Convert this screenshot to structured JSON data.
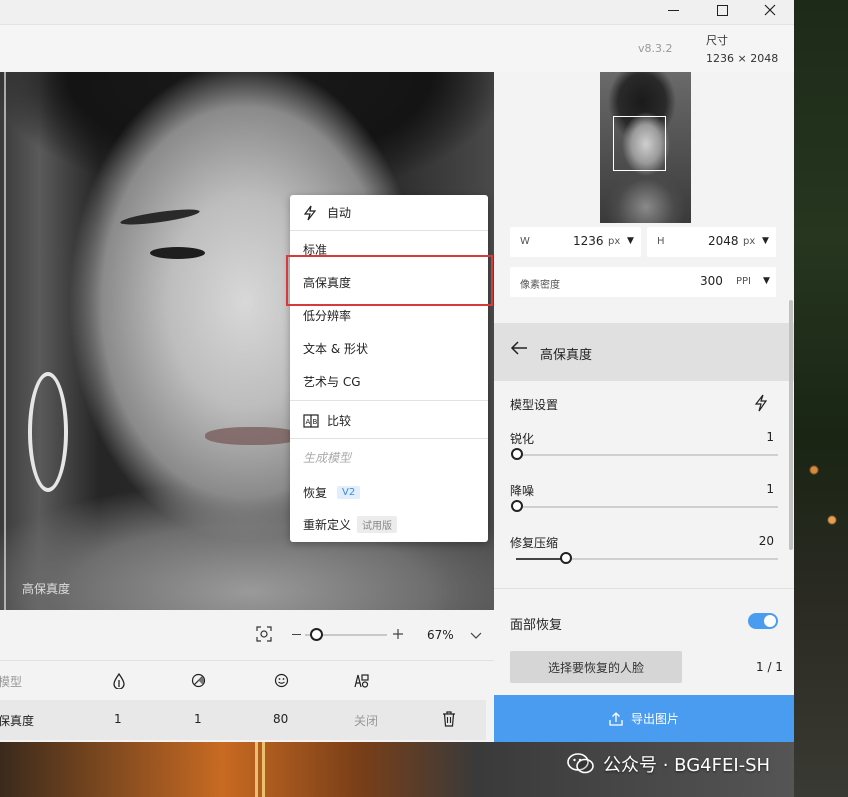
{
  "window": {
    "controls": {
      "minimize": "—",
      "maximize": "☐",
      "close": "✕"
    },
    "version": "v8.3.2",
    "size_label": "尺寸",
    "size_value": "1236 × 2048"
  },
  "preview": {
    "overlay_label": "高保真度"
  },
  "menu": {
    "items": [
      {
        "label": "自动",
        "icon": "lightning-icon"
      },
      {
        "label": "标准"
      },
      {
        "label": "高保真度",
        "highlighted": true
      },
      {
        "label": "低分辨率"
      },
      {
        "label": "文本 & 形状"
      },
      {
        "label": "艺术与 CG"
      },
      {
        "label": "比较",
        "icon": "compare-icon"
      },
      {
        "label": "生成模型",
        "disabled": true
      },
      {
        "label": "恢复",
        "badge": "V2"
      },
      {
        "label": "重新定义",
        "badge": "试用版"
      }
    ]
  },
  "zoom": {
    "percent": "67%"
  },
  "table": {
    "header": {
      "model": "模型"
    },
    "row": {
      "model": "保真度",
      "sharpen": "1",
      "denoise": "1",
      "face": "80",
      "status": "关闭"
    }
  },
  "panel": {
    "width": {
      "label": "W",
      "value": "1236",
      "unit": "px"
    },
    "height": {
      "label": "H",
      "value": "2048",
      "unit": "px"
    },
    "ppi": {
      "label": "像素密度",
      "value": "300",
      "unit": "PPI"
    },
    "model_title": "高保真度",
    "model_settings": "模型设置",
    "sliders": [
      {
        "label": "锐化",
        "value": "1",
        "level": 0.02
      },
      {
        "label": "降噪",
        "value": "1",
        "level": 0.02
      },
      {
        "label": "修复压缩",
        "value": "20",
        "level": 0.2
      }
    ],
    "face_restore": {
      "title": "面部恢复",
      "enabled": true,
      "button": "选择要恢复的人脸",
      "count": "1 / 1"
    },
    "export": "导出图片"
  },
  "watermark": {
    "text": "公众号 · BG4FEI-SH"
  },
  "colors": {
    "accent": "#4a9cf0",
    "highlight": "#d63a3a"
  }
}
